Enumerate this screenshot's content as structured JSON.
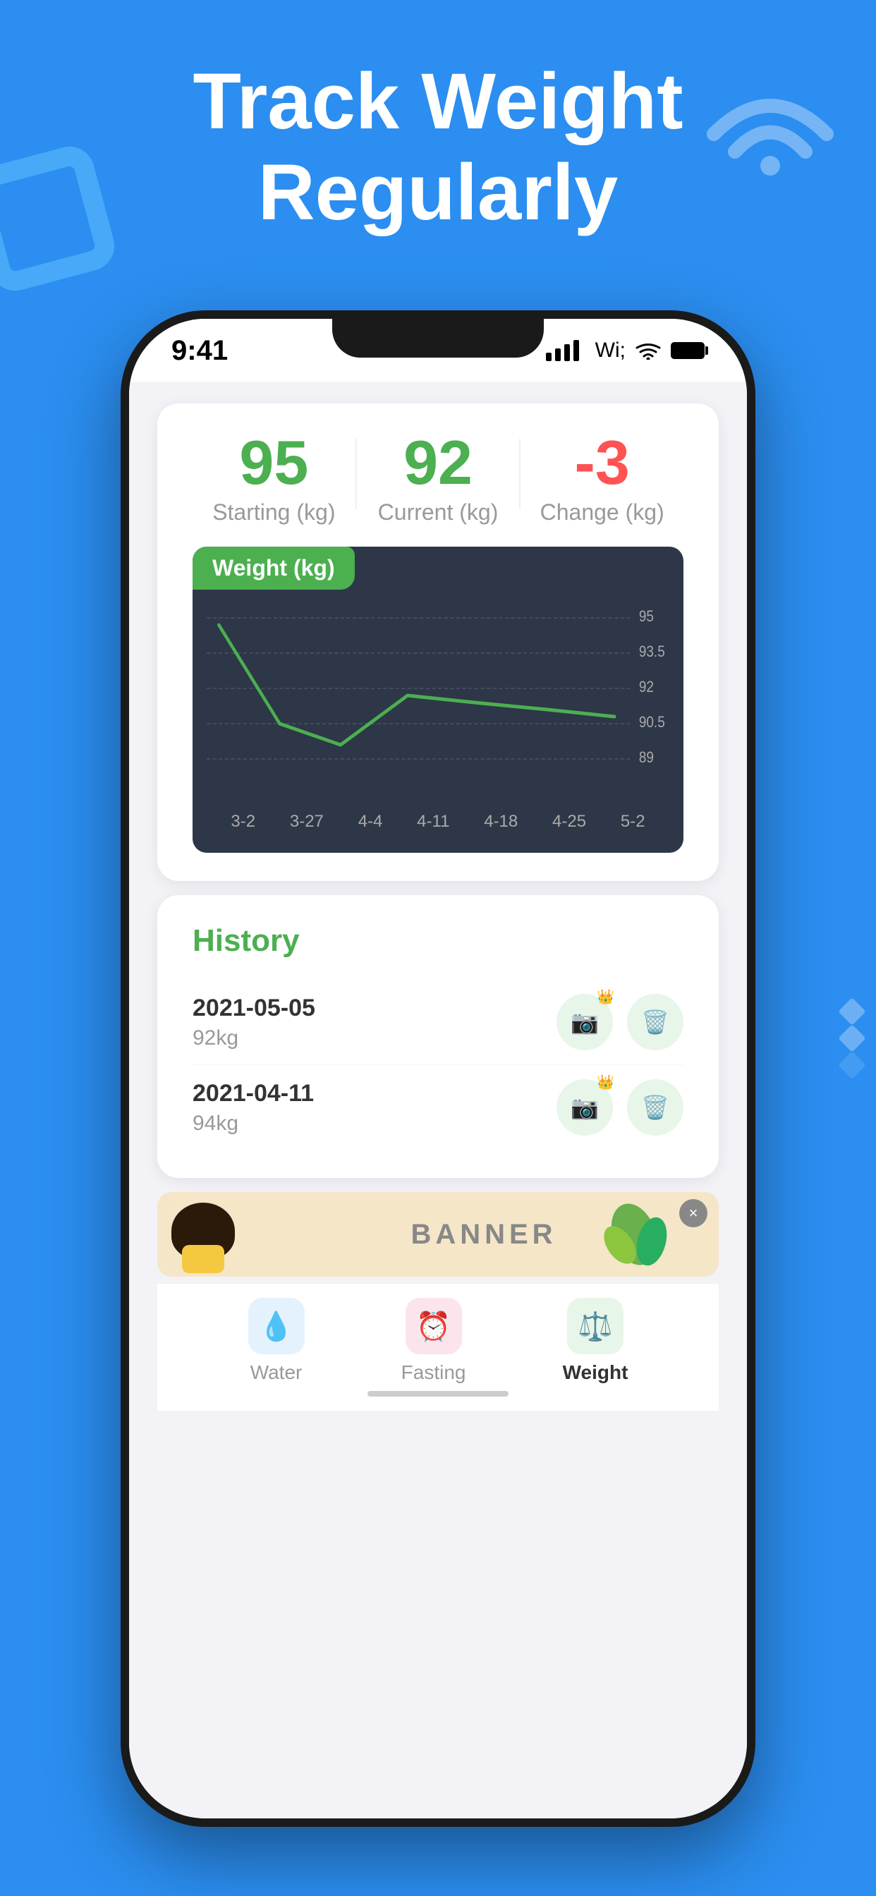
{
  "hero": {
    "title_line1": "Track Weight",
    "title_line2": "Regularly",
    "background_color": "#2B8EF0"
  },
  "status_bar": {
    "time": "9:41"
  },
  "stats": {
    "starting_value": "95",
    "starting_label": "Starting (kg)",
    "current_value": "92",
    "current_label": "Current (kg)",
    "change_value": "-3",
    "change_label": "Change (kg)"
  },
  "chart": {
    "title": "Weight",
    "unit": "(kg)",
    "y_labels": [
      "95",
      "93.5",
      "92",
      "90.5",
      "89"
    ],
    "x_labels": [
      "3-2",
      "3-27",
      "4-4",
      "4-11",
      "4-18",
      "4-25",
      "5-2"
    ]
  },
  "history": {
    "title": "History",
    "items": [
      {
        "date": "2021-05-05",
        "weight": "92kg"
      },
      {
        "date": "2021-04-11",
        "weight": "94kg"
      }
    ]
  },
  "banner": {
    "text": "BANNER",
    "close_label": "×"
  },
  "tabs": [
    {
      "id": "water",
      "label": "Water",
      "icon": "💧",
      "active": false
    },
    {
      "id": "fasting",
      "label": "Fasting",
      "icon": "⏰",
      "active": false
    },
    {
      "id": "weight",
      "label": "Weight",
      "icon": "⚖️",
      "active": true
    }
  ]
}
